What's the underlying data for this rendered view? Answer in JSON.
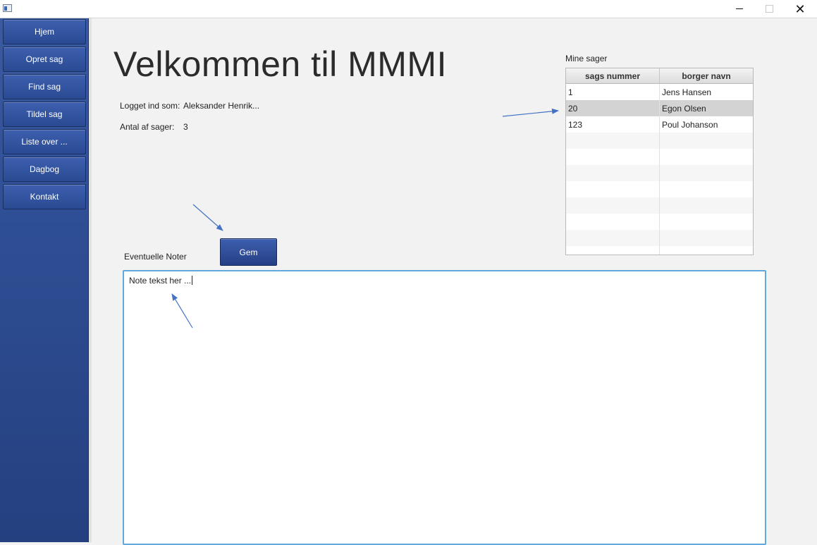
{
  "sidebar": {
    "items": [
      {
        "label": "Hjem"
      },
      {
        "label": "Opret sag"
      },
      {
        "label": "Find sag"
      },
      {
        "label": "Tildel sag"
      },
      {
        "label": "Liste over ..."
      },
      {
        "label": "Dagbog"
      },
      {
        "label": "Kontakt"
      }
    ]
  },
  "main": {
    "title": "Velkommen til MMMI",
    "logged_in_label": "Logget ind som:",
    "logged_in_value": "Aleksander Henrik...",
    "case_count_label": "Antal af sager:",
    "case_count_value": "3"
  },
  "cases": {
    "caption": "Mine sager",
    "columns": [
      "sags nummer",
      "borger navn"
    ],
    "rows": [
      {
        "number": "1",
        "name": "Jens Hansen"
      },
      {
        "number": "20",
        "name": "Egon Olsen"
      },
      {
        "number": "123",
        "name": "Poul Johanson"
      }
    ],
    "selected_row": 2
  },
  "notes": {
    "label": "Eventuelle Noter",
    "save_label": "Gem",
    "text": "Note tekst her ..."
  },
  "colors": {
    "sidebar": "#2f4f96",
    "button": "#2a4a92",
    "focus_border": "#5fa9dd",
    "annotation_arrow": "#4472c4"
  }
}
